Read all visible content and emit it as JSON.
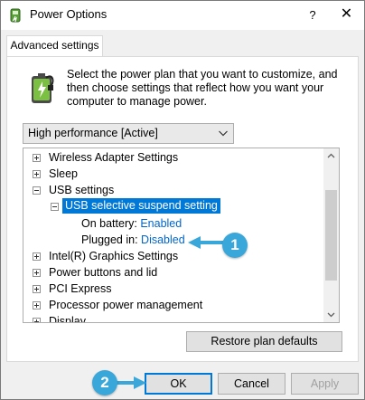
{
  "window": {
    "title": "Power Options",
    "help_glyph": "?",
    "close_glyph": "✕"
  },
  "tab": {
    "label": "Advanced settings"
  },
  "intro": {
    "text": "Select the power plan that you want to customize, and then choose settings that reflect how you want your computer to manage power."
  },
  "plan_dropdown": {
    "selected": "High performance [Active]"
  },
  "tree": {
    "items": [
      {
        "label": "Wireless Adapter Settings",
        "expander": "plus"
      },
      {
        "label": "Sleep",
        "expander": "plus"
      },
      {
        "label": "USB settings",
        "expander": "minus"
      },
      {
        "label": "USB selective suspend setting",
        "expander": "minus",
        "selected": true
      },
      {
        "label": "On battery:",
        "value": "Enabled"
      },
      {
        "label": "Plugged in:",
        "value": "Disabled"
      },
      {
        "label": "Intel(R) Graphics Settings",
        "expander": "plus"
      },
      {
        "label": "Power buttons and lid",
        "expander": "plus"
      },
      {
        "label": "PCI Express",
        "expander": "plus"
      },
      {
        "label": "Processor power management",
        "expander": "plus"
      },
      {
        "label": "Display",
        "expander": "plus"
      }
    ]
  },
  "buttons": {
    "restore": "Restore plan defaults",
    "ok": "OK",
    "cancel": "Cancel",
    "apply": "Apply"
  },
  "callouts": {
    "one": "1",
    "two": "2"
  },
  "colors": {
    "selection": "#0078d7",
    "link": "#0066cc",
    "callout": "#39a7d9"
  },
  "icons": {
    "title_icon": "power-plan-icon",
    "plan_icon": "battery-plug-icon"
  }
}
